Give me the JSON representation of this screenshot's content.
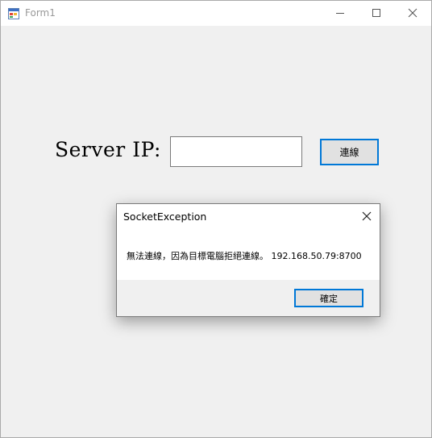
{
  "window": {
    "title": "Form1",
    "icon": "winforms-app-icon",
    "controls": {
      "minimize": "minimize-icon",
      "maximize": "maximize-icon",
      "close": "close-icon"
    }
  },
  "form": {
    "server_label": "Server IP:",
    "ip_value": "",
    "connect_label": "連線"
  },
  "dialog": {
    "title": "SocketException",
    "message": "無法連線，因為目標電腦拒絕連線。 192.168.50.79:8700",
    "ok_label": "確定",
    "close_icon": "close-icon"
  },
  "colors": {
    "accent": "#0078d7",
    "window_bg": "#f0f0f0",
    "button_bg": "#e1e1e1"
  }
}
